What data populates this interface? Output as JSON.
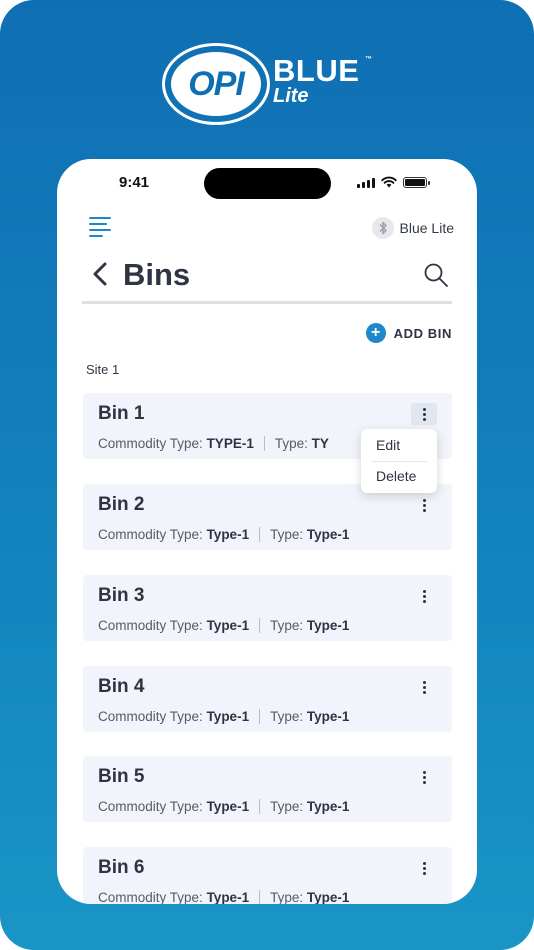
{
  "brand": {
    "logo_mark": "OPI",
    "name": "BLUE",
    "trademark": "™",
    "subtitle": "Lite"
  },
  "status_bar": {
    "time": "9:41",
    "icons": [
      "cellular-signal-icon",
      "wifi-icon",
      "battery-icon"
    ]
  },
  "header": {
    "menu_icon": "hamburger-menu-icon",
    "bluetooth_icon": "bluetooth-icon",
    "device_label": "Blue Lite",
    "back_icon": "chevron-left-icon",
    "title": "Bins",
    "search_icon": "search-icon"
  },
  "actions": {
    "add_bin_label": "ADD BIN",
    "add_icon": "plus-circle-icon"
  },
  "site": {
    "label": "Site 1"
  },
  "bins": [
    {
      "name": "Bin 1",
      "commodity_label": "Commodity Type:",
      "commodity_value": "TYPE-1",
      "type_label": "Type:",
      "type_value": "TY"
    },
    {
      "name": "Bin 2",
      "commodity_label": "Commodity Type:",
      "commodity_value": "Type-1",
      "type_label": "Type:",
      "type_value": "Type-1"
    },
    {
      "name": "Bin 3",
      "commodity_label": "Commodity Type:",
      "commodity_value": "Type-1",
      "type_label": "Type:",
      "type_value": "Type-1"
    },
    {
      "name": "Bin 4",
      "commodity_label": "Commodity Type:",
      "commodity_value": "Type-1",
      "type_label": "Type:",
      "type_value": "Type-1"
    },
    {
      "name": "Bin 5",
      "commodity_label": "Commodity Type:",
      "commodity_value": "Type-1",
      "type_label": "Type:",
      "type_value": "Type-1"
    },
    {
      "name": "Bin 6",
      "commodity_label": "Commodity Type:",
      "commodity_value": "Type-1",
      "type_label": "Type:",
      "type_value": "Type-1"
    }
  ],
  "context_menu": {
    "items": [
      "Edit",
      "Delete"
    ]
  },
  "colors": {
    "background_top": "#0f6fb3",
    "background_bottom": "#1a95c6",
    "accent": "#1e88c9",
    "card": "#f1f4fa",
    "text_dark": "#2f3442"
  }
}
